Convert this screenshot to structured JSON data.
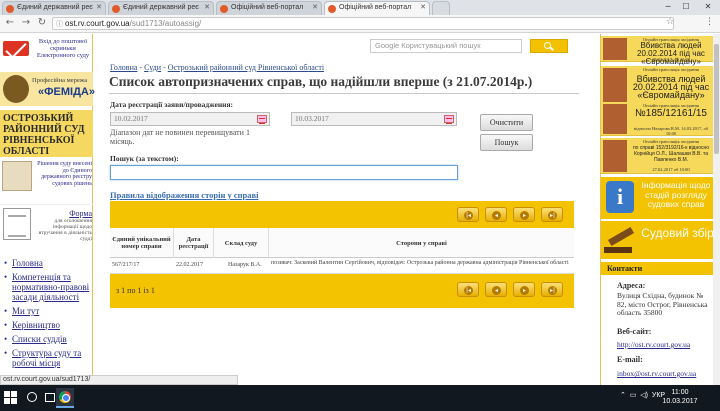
{
  "browser": {
    "tabs": [
      {
        "title": "Єдиний державний реє",
        "active": false
      },
      {
        "title": "Єдиний державний реє",
        "active": false
      },
      {
        "title": "Офіційний веб-портал",
        "active": false
      },
      {
        "title": "Офіційний веб-портал",
        "active": true
      }
    ],
    "url_host": "ost.rv.court.gov.ua",
    "url_path": "/sud1713/autoassig/",
    "status_url": "ost.rv.court.gov.ua/sud1713/"
  },
  "left": {
    "mail_text": "Вхід до поштової скриньки Електронного суду",
    "femida_sub": "Професійна мережа",
    "femida_name": "«ФЕМІДА»",
    "court_name": "ОСТРОЗЬКИЙ РАЙОННИЙ СУД РІВНЕНСЬКОЇ ОБЛАСТІ",
    "register_text": "Рішення суду внесені до Єдиного державного реєстру судових рішень",
    "form_title": "Форма",
    "form_text": "для оголошення інформації щодо втручання в діяльність судді",
    "nav": [
      "Головна",
      "Компетенція та нормативно-правові засади діяльності",
      "Ми тут",
      "Керівництво",
      "Списки суддів",
      "Структура суду та робочі місця"
    ]
  },
  "main": {
    "search_placeholder": "Google Користувацький пошук",
    "breadcrumb": {
      "home": "Головна",
      "sep": " - ",
      "courts": "Суди",
      "court": "Острозький районний суд Рівненської області"
    },
    "title": "Список автопризначених справ, що надійшли вперше (з 21.07.2014р.)",
    "date_label": "Дата реєстрації заяви/провадження:",
    "date_from": "10.02.2017",
    "date_to": "10.03.2017",
    "clear_btn": "Очистити",
    "search_btn": "Пошук",
    "hint": "Діапазон дат не повинен перевищувати 1 місяць.",
    "text_search_label": "Пошук (за текстом):",
    "text_search_value": "",
    "rules_link": "Правила відображення сторін у справі",
    "table": {
      "headers": [
        "Єдиний унікальний номер справи",
        "Дата реєстрації",
        "Склад суду",
        "Сторони у справі"
      ],
      "rows": [
        {
          "num": "567/217/17",
          "date": "22.02.2017",
          "judge": "Назарук В.А.",
          "parties": "позивач: Заскевий Валентин Сергійович, відповідач: Острозька районна державна адміністрація Рівненської області"
        }
      ]
    },
    "page_info": "з 1 по 1 із 1",
    "pager_icons": [
      "first-page-icon",
      "prev-page-icon",
      "next-page-icon",
      "last-page-icon"
    ]
  },
  "right": {
    "banners": [
      {
        "small": "Онлайн трансляція засідання",
        "big": "Вбивства людей 20.02.2014 під час «Євромайдану»",
        "date": "18.04.2017, об 11:30"
      },
      {
        "small": "Онлайн трансляція засідання",
        "big": "№185/12161/15",
        "date": "відносно Назарова В.М. 14.03.2017, об 10:00"
      },
      {
        "small": "Онлайн трансляція засідання",
        "big": "по справі 152/3192/16-к відносно Корнійця О.Л., Шалашки В.В. та Павленко В.М.",
        "date": "27.02.2017 об 10:00"
      }
    ],
    "info_text": "Інформація щодо стадій розгляду судових справ",
    "fee_text": "Судовий збір",
    "contacts_title": "Контакти",
    "address_label": "Адреса:",
    "address": "Вулиця Східна, будинок № 82, місто Острог, Рівненська область 35800",
    "website_label": "Веб-сайт:",
    "website": "http://ost.rv.court.gov.ua",
    "email_label": "E-mail:",
    "email": "inbox@ost.rv.court.gov.ua"
  },
  "taskbar": {
    "lang": "УКР",
    "time": "11:00",
    "date": "10.03.2017"
  }
}
